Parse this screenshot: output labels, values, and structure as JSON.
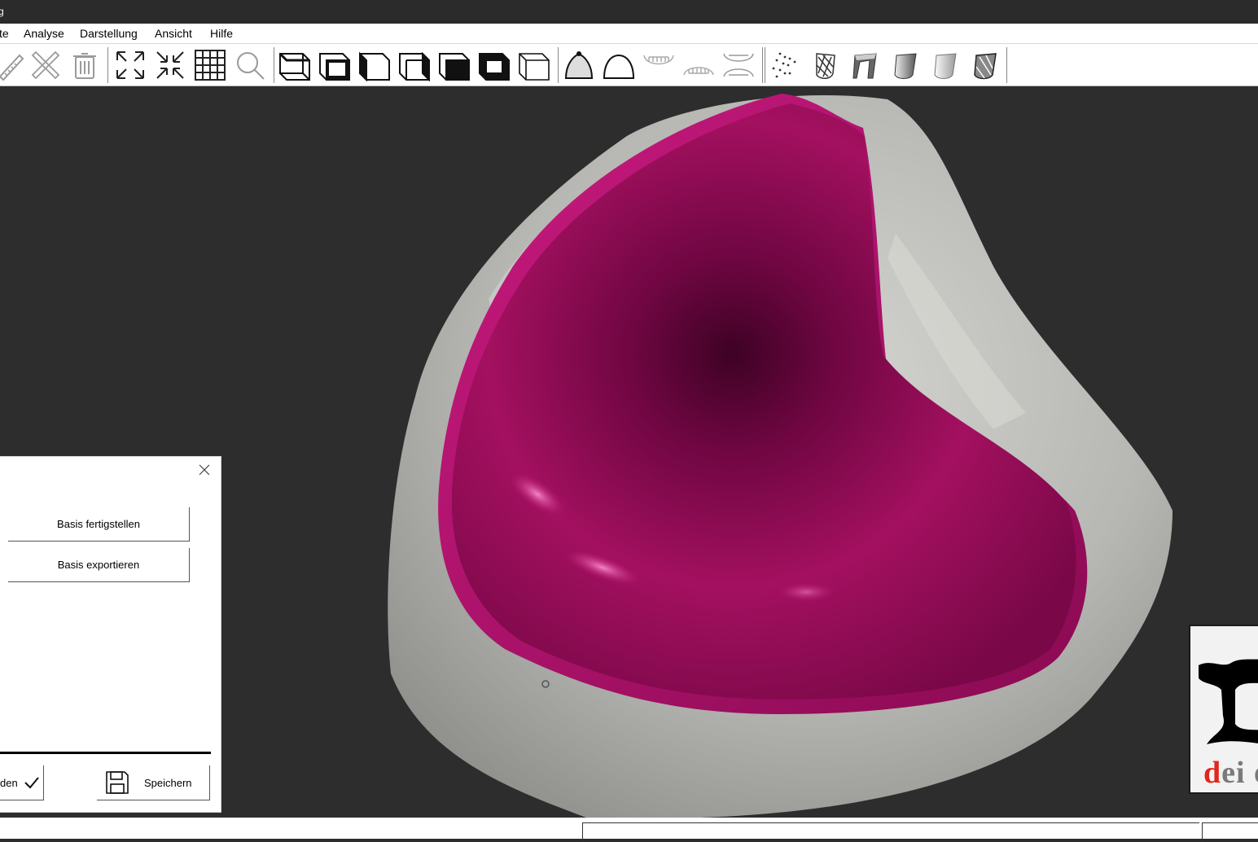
{
  "titlebar": {
    "title": "g"
  },
  "menu": [
    "te",
    "Analyse",
    "Darstellung",
    "Ansicht",
    "Hilfe"
  ],
  "toolbar": {
    "groups": [
      [
        "ruler-icon",
        "measure-cross-icon",
        "trash-icon"
      ],
      [
        "expand-icon",
        "shrink-icon",
        "grid-icon",
        "zoom-icon"
      ],
      [
        "cube-front-icon",
        "cube-back-icon",
        "cube-left-icon",
        "cube-right-icon",
        "cube-top-icon",
        "cube-bottom-icon",
        "cube-wire-icon"
      ],
      [
        "model-dotted-icon",
        "model-dome-icon",
        "upper-jaw-icon",
        "lower-jaw-icon",
        "both-jaws-icon"
      ],
      [
        "point-cloud-icon",
        "tooth-wire-icon",
        "tooth-side-icon",
        "tooth-shaded-icon",
        "tooth-light-icon",
        "tooth-dark-icon"
      ]
    ]
  },
  "panel": {
    "finish_label": "Basis fertigstellen",
    "export_label": "Basis exportieren",
    "apply_label": "den",
    "save_label": "Speichern"
  },
  "logo": {
    "first": "d",
    "rest": "ei e"
  },
  "colors": {
    "base": "#a3105f",
    "plaster": "#b9b9b5",
    "background": "#2d2d2d"
  }
}
